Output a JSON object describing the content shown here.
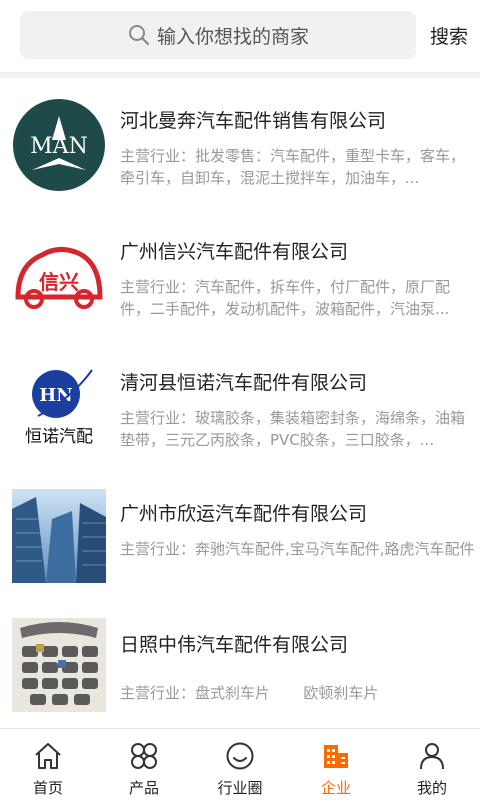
{
  "search": {
    "placeholder": "输入你想找的商家",
    "button": "搜索"
  },
  "companies": [
    {
      "name": "河北曼奔汽车配件销售有限公司",
      "desc": "主营行业：批发零售：汽车配件，重型卡车，客车，牵引车，自卸车，混泥土搅拌车，加油车，...",
      "logo_text": "MAN"
    },
    {
      "name": "广州信兴汽车配件有限公司",
      "desc": "主营行业：汽车配件，拆车件，付厂配件，原厂配件，二手配件，发动机配件，波箱配件，汽油泵...",
      "logo_text": "信兴"
    },
    {
      "name": "清河县恒诺汽车配件有限公司",
      "desc": "主营行业：玻璃胶条，集装箱密封条，海绵条，油箱垫带，三元乙丙胶条，PVC胶条，三口胶条，...",
      "logo_text": "HN",
      "logo_caption": "恒诺汽配"
    },
    {
      "name": "广州市欣运汽车配件有限公司",
      "desc": "主营行业：奔驰汽车配件,宝马汽车配件,路虎汽车配件"
    },
    {
      "name": "日照中伟汽车配件有限公司",
      "desc": "主营行业：盘式刹车片       欧顿刹车片"
    }
  ],
  "tabs": [
    {
      "label": "首页",
      "icon": "home-icon"
    },
    {
      "label": "产品",
      "icon": "grid-icon"
    },
    {
      "label": "行业圈",
      "icon": "smile-icon"
    },
    {
      "label": "企业",
      "icon": "building-icon",
      "active": true
    },
    {
      "label": "我的",
      "icon": "user-icon"
    }
  ],
  "colors": {
    "accent": "#ff6a00",
    "text": "#222222",
    "muted": "#999999"
  }
}
